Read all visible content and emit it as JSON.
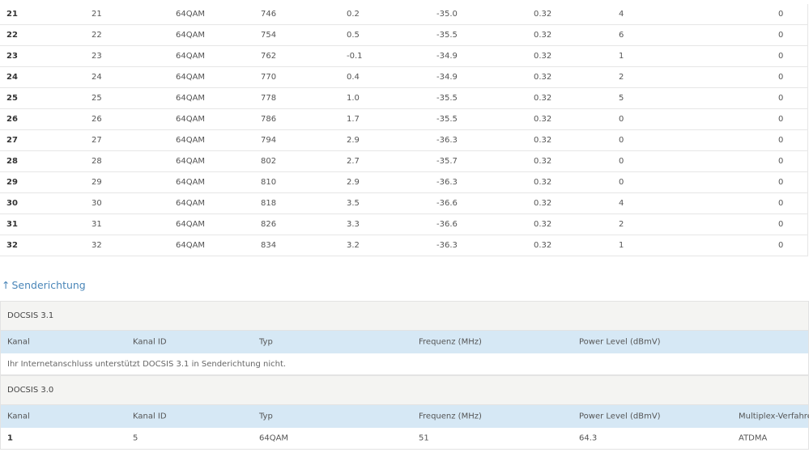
{
  "downstream_rows": [
    [
      "21",
      "21",
      "64QAM",
      "746",
      "0.2",
      "-35.0",
      "0.32",
      "4",
      "0"
    ],
    [
      "22",
      "22",
      "64QAM",
      "754",
      "0.5",
      "-35.5",
      "0.32",
      "6",
      "0"
    ],
    [
      "23",
      "23",
      "64QAM",
      "762",
      "-0.1",
      "-34.9",
      "0.32",
      "1",
      "0"
    ],
    [
      "24",
      "24",
      "64QAM",
      "770",
      "0.4",
      "-34.9",
      "0.32",
      "2",
      "0"
    ],
    [
      "25",
      "25",
      "64QAM",
      "778",
      "1.0",
      "-35.5",
      "0.32",
      "5",
      "0"
    ],
    [
      "26",
      "26",
      "64QAM",
      "786",
      "1.7",
      "-35.5",
      "0.32",
      "0",
      "0"
    ],
    [
      "27",
      "27",
      "64QAM",
      "794",
      "2.9",
      "-36.3",
      "0.32",
      "0",
      "0"
    ],
    [
      "28",
      "28",
      "64QAM",
      "802",
      "2.7",
      "-35.7",
      "0.32",
      "0",
      "0"
    ],
    [
      "29",
      "29",
      "64QAM",
      "810",
      "2.9",
      "-36.3",
      "0.32",
      "0",
      "0"
    ],
    [
      "30",
      "30",
      "64QAM",
      "818",
      "3.5",
      "-36.6",
      "0.32",
      "4",
      "0"
    ],
    [
      "31",
      "31",
      "64QAM",
      "826",
      "3.3",
      "-36.6",
      "0.32",
      "2",
      "0"
    ],
    [
      "32",
      "32",
      "64QAM",
      "834",
      "3.2",
      "-36.3",
      "0.32",
      "1",
      "0"
    ]
  ],
  "upstream": {
    "heading": "Senderichtung",
    "arrow": "↑",
    "docsis31": {
      "title": "DOCSIS 3.1",
      "headers": [
        "Kanal",
        "Kanal ID",
        "Typ",
        "Frequenz (MHz)",
        "Power Level (dBmV)"
      ],
      "note": "Ihr Internetanschluss unterstützt DOCSIS 3.1 in Senderichtung nicht."
    },
    "docsis30": {
      "title": "DOCSIS 3.0",
      "headers": [
        "Kanal",
        "Kanal ID",
        "Typ",
        "Frequenz (MHz)",
        "Power Level (dBmV)",
        "Multiplex-Verfahren"
      ],
      "rows": [
        [
          "1",
          "5",
          "64QAM",
          "51",
          "64.3",
          "ATDMA"
        ]
      ]
    }
  },
  "colors": {
    "link": "#4a86b8",
    "header_bg": "#d6e8f5",
    "title_bg": "#f4f4f2"
  }
}
